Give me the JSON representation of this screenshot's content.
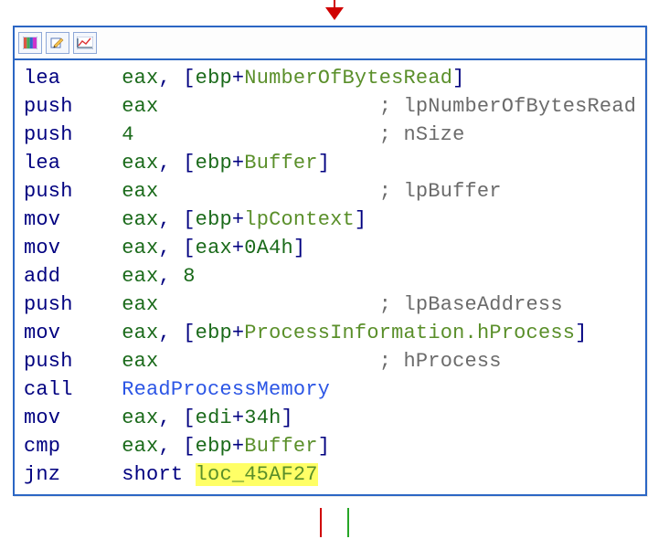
{
  "arrow_in": {
    "color": "#d00000"
  },
  "toolbar": {
    "icons": [
      "palette-icon",
      "edit-icon",
      "chart-icon"
    ]
  },
  "code": {
    "mnemonic_pad": 8,
    "operand_pad": 21,
    "lines": [
      {
        "mnemonic": "lea",
        "tokens": [
          {
            "k": "reg",
            "t": "eax"
          },
          {
            "k": "punc",
            "t": ", ["
          },
          {
            "k": "reg",
            "t": "ebp"
          },
          {
            "k": "punc",
            "t": "+"
          },
          {
            "k": "ident",
            "t": "NumberOfBytesRead"
          },
          {
            "k": "punc",
            "t": "]"
          }
        ]
      },
      {
        "mnemonic": "push",
        "tokens": [
          {
            "k": "reg",
            "t": "eax"
          }
        ],
        "comment": "lpNumberOfBytesRead"
      },
      {
        "mnemonic": "push",
        "tokens": [
          {
            "k": "num",
            "t": "4"
          }
        ],
        "comment": "nSize"
      },
      {
        "mnemonic": "lea",
        "tokens": [
          {
            "k": "reg",
            "t": "eax"
          },
          {
            "k": "punc",
            "t": ", ["
          },
          {
            "k": "reg",
            "t": "ebp"
          },
          {
            "k": "punc",
            "t": "+"
          },
          {
            "k": "ident",
            "t": "Buffer"
          },
          {
            "k": "punc",
            "t": "]"
          }
        ]
      },
      {
        "mnemonic": "push",
        "tokens": [
          {
            "k": "reg",
            "t": "eax"
          }
        ],
        "comment": "lpBuffer"
      },
      {
        "mnemonic": "mov",
        "tokens": [
          {
            "k": "reg",
            "t": "eax"
          },
          {
            "k": "punc",
            "t": ", ["
          },
          {
            "k": "reg",
            "t": "ebp"
          },
          {
            "k": "punc",
            "t": "+"
          },
          {
            "k": "ident",
            "t": "lpContext"
          },
          {
            "k": "punc",
            "t": "]"
          }
        ]
      },
      {
        "mnemonic": "mov",
        "tokens": [
          {
            "k": "reg",
            "t": "eax"
          },
          {
            "k": "punc",
            "t": ", ["
          },
          {
            "k": "reg",
            "t": "eax"
          },
          {
            "k": "punc",
            "t": "+"
          },
          {
            "k": "num",
            "t": "0A4h"
          },
          {
            "k": "punc",
            "t": "]"
          }
        ]
      },
      {
        "mnemonic": "add",
        "tokens": [
          {
            "k": "reg",
            "t": "eax"
          },
          {
            "k": "punc",
            "t": ", "
          },
          {
            "k": "num",
            "t": "8"
          }
        ]
      },
      {
        "mnemonic": "push",
        "tokens": [
          {
            "k": "reg",
            "t": "eax"
          }
        ],
        "comment": "lpBaseAddress"
      },
      {
        "mnemonic": "mov",
        "tokens": [
          {
            "k": "reg",
            "t": "eax"
          },
          {
            "k": "punc",
            "t": ", ["
          },
          {
            "k": "reg",
            "t": "ebp"
          },
          {
            "k": "punc",
            "t": "+"
          },
          {
            "k": "ident",
            "t": "ProcessInformation.hProcess"
          },
          {
            "k": "punc",
            "t": "]"
          }
        ]
      },
      {
        "mnemonic": "push",
        "tokens": [
          {
            "k": "reg",
            "t": "eax"
          }
        ],
        "comment": "hProcess"
      },
      {
        "mnemonic": "call",
        "tokens": [
          {
            "k": "call",
            "t": "ReadProcessMemory"
          }
        ]
      },
      {
        "mnemonic": "mov",
        "tokens": [
          {
            "k": "reg",
            "t": "eax"
          },
          {
            "k": "punc",
            "t": ", ["
          },
          {
            "k": "reg",
            "t": "edi"
          },
          {
            "k": "punc",
            "t": "+"
          },
          {
            "k": "num",
            "t": "34h"
          },
          {
            "k": "punc",
            "t": "]"
          }
        ]
      },
      {
        "mnemonic": "cmp",
        "tokens": [
          {
            "k": "reg",
            "t": "eax"
          },
          {
            "k": "punc",
            "t": ", ["
          },
          {
            "k": "reg",
            "t": "ebp"
          },
          {
            "k": "punc",
            "t": "+"
          },
          {
            "k": "ident",
            "t": "Buffer"
          },
          {
            "k": "punc",
            "t": "]"
          }
        ]
      },
      {
        "mnemonic": "jnz",
        "tokens": [
          {
            "k": "kw",
            "t": "short "
          },
          {
            "k": "ident",
            "t": "loc_45AF27",
            "hl": true
          }
        ]
      }
    ]
  },
  "edges_out": {
    "red": "#d00000",
    "green": "#26a626"
  }
}
